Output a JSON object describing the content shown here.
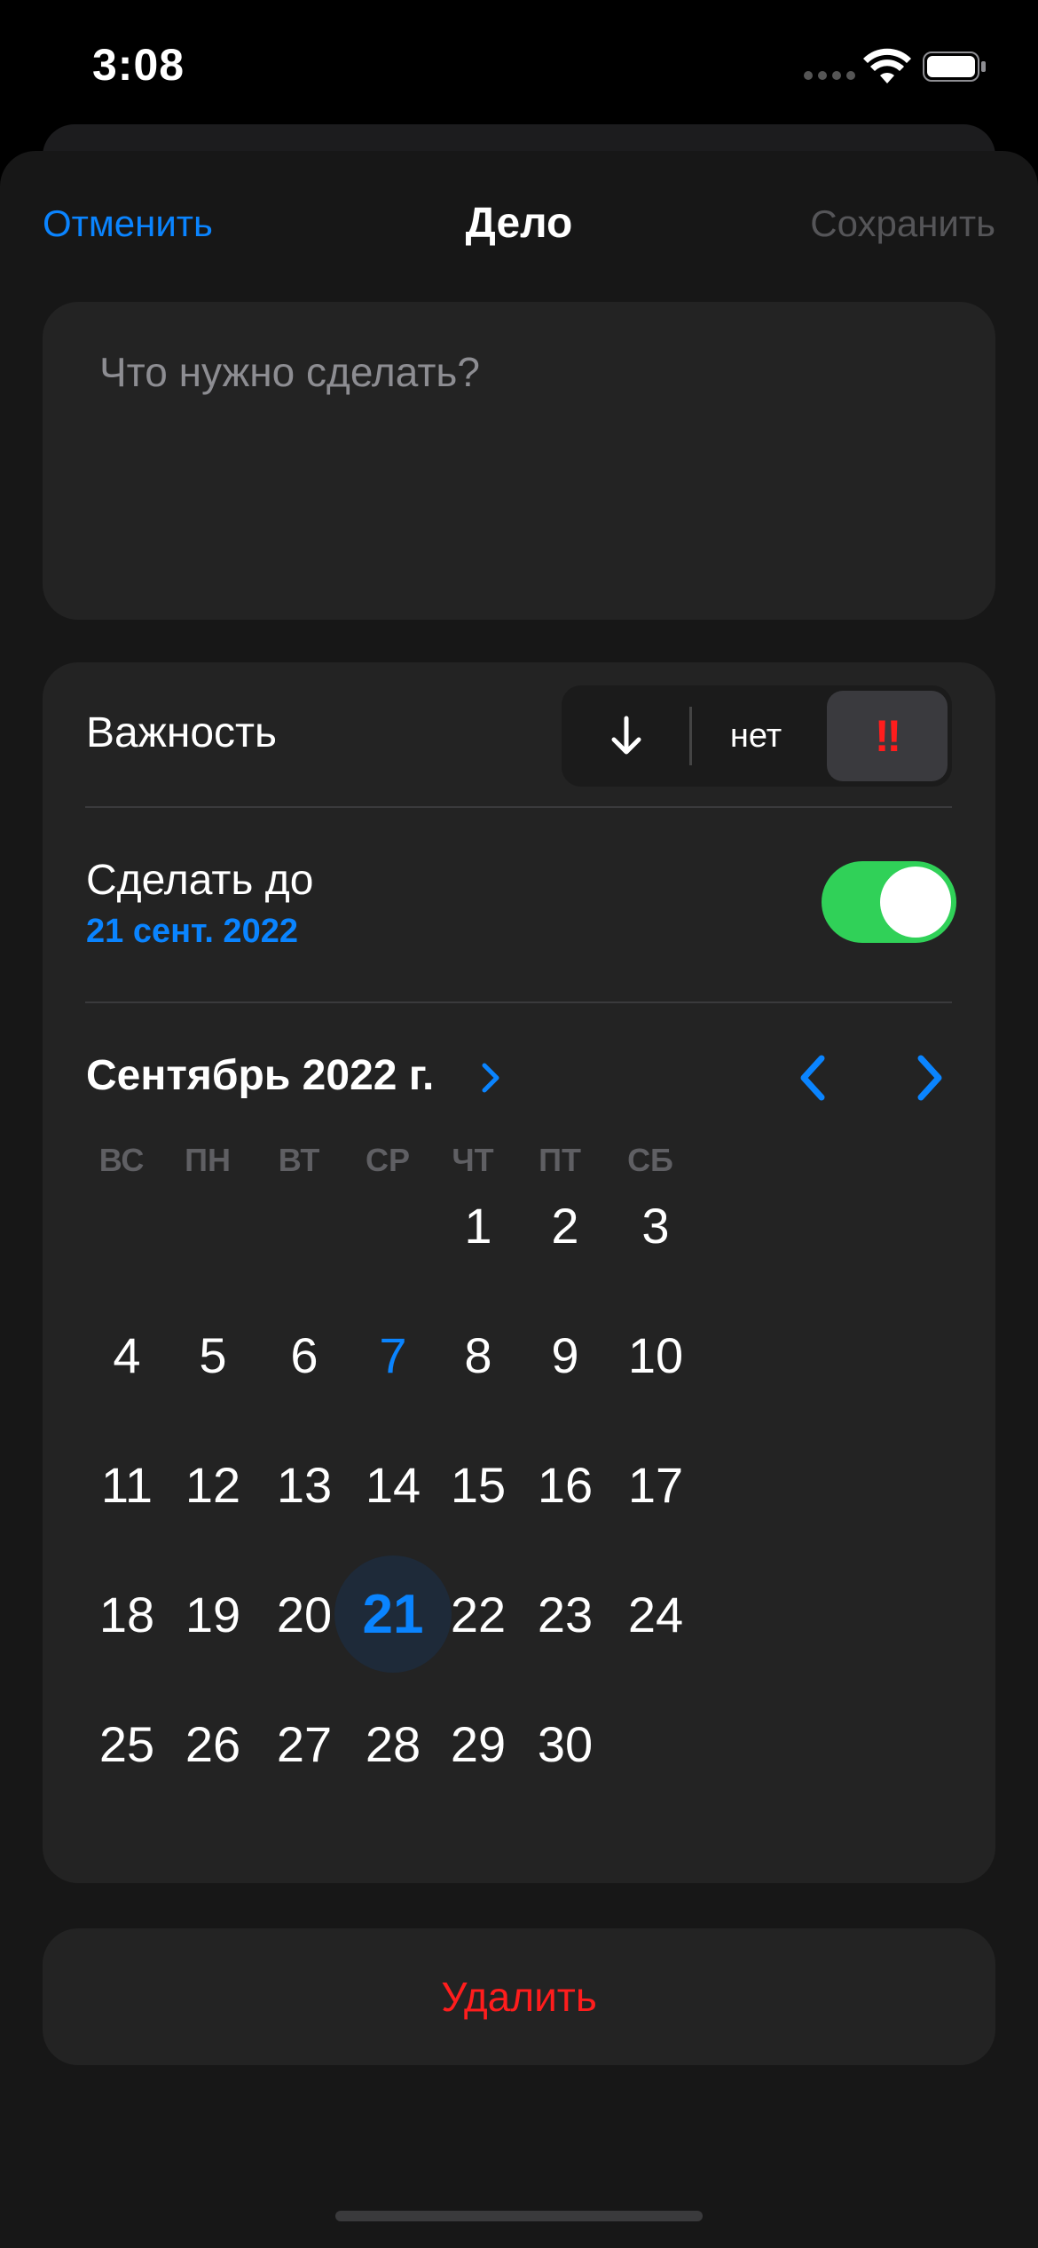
{
  "status_bar": {
    "time": "3:08"
  },
  "nav": {
    "cancel_label": "Отменить",
    "title": "Дело",
    "save_label": "Сохранить"
  },
  "task": {
    "placeholder": "Что нужно сделать?"
  },
  "importance": {
    "label": "Важность",
    "options": [
      {
        "name": "low",
        "icon": "arrow-down-icon",
        "label": ""
      },
      {
        "name": "none",
        "label": "нет"
      },
      {
        "name": "high",
        "label": "‼"
      }
    ],
    "selected": "high"
  },
  "deadline": {
    "label": "Сделать до",
    "date": "21 сент. 2022",
    "enabled": true
  },
  "calendar": {
    "month_label": "Сентябрь 2022 г.",
    "weekdays": [
      "ВС",
      "ПН",
      "ВТ",
      "СР",
      "ЧТ",
      "ПТ",
      "СБ"
    ],
    "days": [
      [
        "",
        "",
        "",
        "",
        "1",
        "2",
        "3"
      ],
      [
        "4",
        "5",
        "6",
        "7",
        "8",
        "9",
        "10"
      ],
      [
        "11",
        "12",
        "13",
        "14",
        "15",
        "16",
        "17"
      ],
      [
        "18",
        "19",
        "20",
        "21",
        "22",
        "23",
        "24"
      ],
      [
        "25",
        "26",
        "27",
        "28",
        "29",
        "30",
        ""
      ]
    ],
    "today": "7",
    "selected": "21"
  },
  "delete_label": "Удалить",
  "colors": {
    "accent": "#0a84ff",
    "danger": "#ff1d1d",
    "toggle_on": "#30d158",
    "card": "#232323",
    "sheet": "#171717"
  }
}
